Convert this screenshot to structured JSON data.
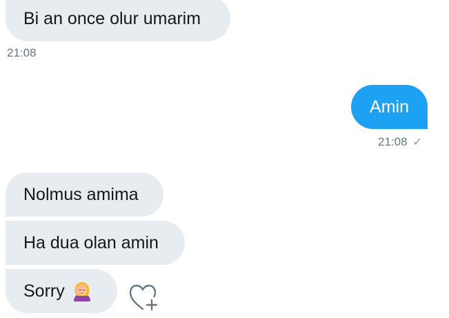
{
  "messages": [
    {
      "text": "Bi an once olur umarim",
      "time": "21:08"
    },
    {
      "text": "Amin",
      "time": "21:08",
      "status_icon": "checkmark-icon"
    },
    {
      "text": "Nolmus amima"
    },
    {
      "text": "Ha dua olan amin"
    },
    {
      "text": "Sorry",
      "emoji": "woman-facepalming-emoji"
    }
  ],
  "actions": {
    "like_icon": "heart-plus-icon"
  },
  "colors": {
    "incoming_bubble": "#e6ecf0",
    "outgoing_bubble": "#1da1f2",
    "text": "#14171a",
    "timestamp": "#657786"
  }
}
